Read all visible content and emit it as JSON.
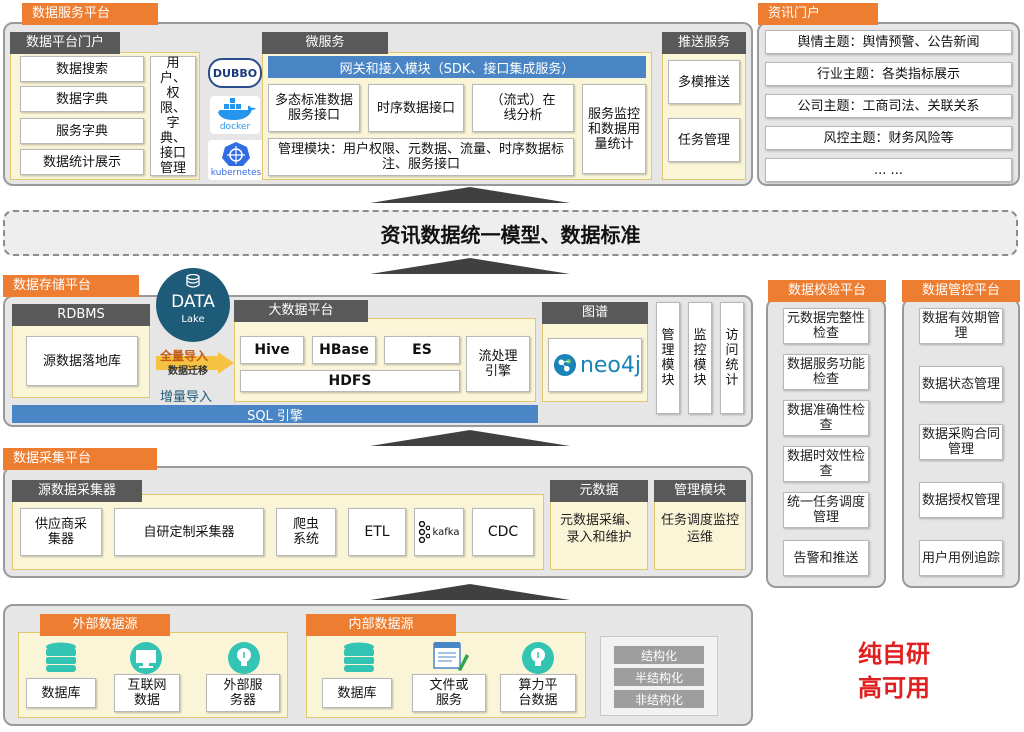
{
  "service": {
    "tab": "数据服务平台",
    "portal_tab": "数据平台门户",
    "portal_items": [
      "数据搜索",
      "数据字典",
      "服务字典",
      "数据统计展示"
    ],
    "portal_side": "用户、权限、字典、接口管理",
    "logos": [
      "DUBBO",
      "docker",
      "kubernetes"
    ],
    "micro_tab": "微服务",
    "gateway": "网关和接入模块（SDK、接口集成服务）",
    "micro_items": [
      "多态标准数据服务接口",
      "时序数据接口",
      "（流式）在线分析"
    ],
    "micro_monitor": "服务监控和数据用量统计",
    "micro_mgmt": "管理模块：用户权限、元数据、流量、时序数据标注、服务接口",
    "push_tab": "推送服务",
    "push_items": [
      "多模推送",
      "任务管理"
    ]
  },
  "info_portal": {
    "tab": "资讯门户",
    "items": [
      "舆情主题：舆情预警、公告新闻",
      "行业主题：各类指标展示",
      "公司主题：工商司法、关联关系",
      "风控主题：财务风险等",
      "... ..."
    ]
  },
  "banner": "资讯数据统一模型、数据标准",
  "storage": {
    "tab": "数据存储平台",
    "rdbms_tab": "RDBMS",
    "rdbms_item": "源数据落地库",
    "lake_title": "DATA",
    "lake_sub": "Lake",
    "arrow_full": "全量导入",
    "arrow_mid": "数据迁移",
    "arrow_inc": "增量导入",
    "bigdata_tab": "大数据平台",
    "bigdata_items": [
      "Hive",
      "HBase",
      "ES"
    ],
    "hdfs": "HDFS",
    "stream": "流处理引擎",
    "graph_tab": "图谱",
    "neo4j": "neo4j",
    "side_items": [
      "管理模块",
      "监控模块",
      "访问统计"
    ],
    "sql": "SQL 引擎"
  },
  "collect": {
    "tab": "数据采集平台",
    "src_tab": "源数据采集器",
    "items": [
      "供应商采集器",
      "自研定制采集器",
      "爬虫系统",
      "ETL",
      "kafka",
      "CDC"
    ],
    "meta_tab": "元数据",
    "meta_item": "元数据采编、录入和维护",
    "mgmt_tab": "管理模块",
    "mgmt_item": "任务调度监控运维"
  },
  "sources": {
    "external_tab": "外部数据源",
    "external": [
      "数据库",
      "互联网数据",
      "外部服务器"
    ],
    "internal_tab": "内部数据源",
    "internal": [
      "数据库",
      "文件或服务",
      "算力平台数据"
    ],
    "types": [
      "结构化",
      "半结构化",
      "非结构化"
    ]
  },
  "verify": {
    "tab": "数据校验平台",
    "items": [
      "元数据完整性检查",
      "数据服务功能检查",
      "数据准确性检查",
      "数据时效性检查",
      "统一任务调度管理",
      "告警和推送"
    ]
  },
  "govern": {
    "tab": "数据管控平台",
    "items": [
      "数据有效期管理",
      "数据状态管理",
      "数据采购合同管理",
      "数据授权管理",
      "用户用例追踪"
    ]
  },
  "slogan": [
    "纯自研",
    "高可用"
  ],
  "colors": {
    "accent": "#ed7d31",
    "dark": "#595959",
    "blue": "#4a86c6",
    "red": "#e02020"
  }
}
